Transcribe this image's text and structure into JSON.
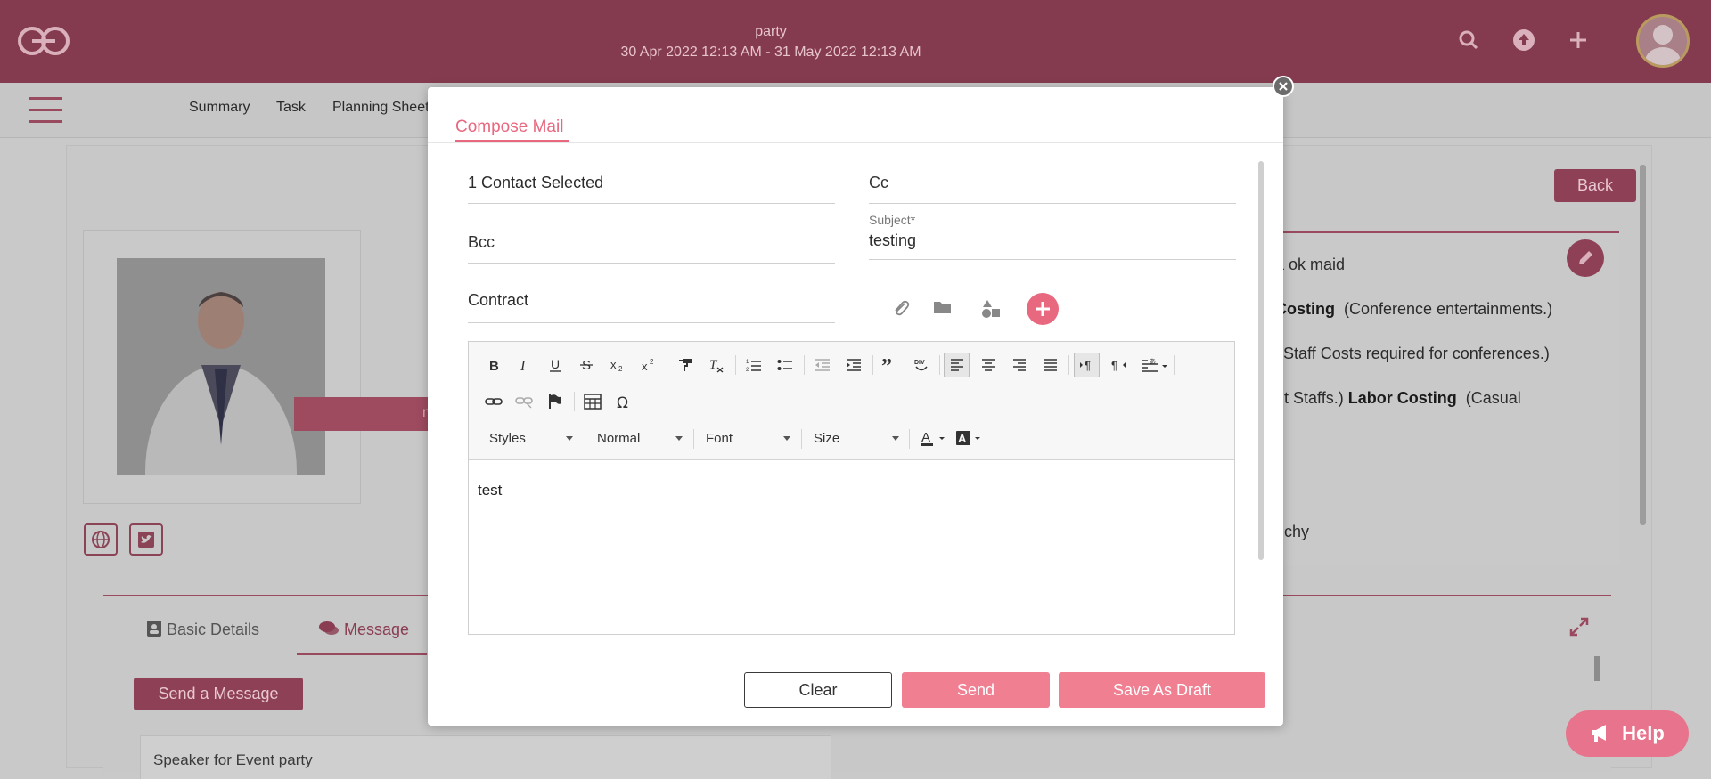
{
  "header": {
    "event_title": "party",
    "event_dates": "30 Apr 2022 12:13 AM - 31 May 2022 12:13 AM",
    "brand_color": "#853b4f"
  },
  "nav": {
    "items": [
      "Summary",
      "Task",
      "Planning Sheet"
    ]
  },
  "background": {
    "back_label": "Back",
    "detail_lines": [
      {
        "plain": "a ok maid",
        "bold": "",
        "rest": ""
      },
      {
        "plain": "",
        "bold": "Costing",
        "rest": "  (Conference entertainments.)"
      },
      {
        "plain": "l Staff Costs required for conferences.)",
        "bold": "",
        "rest": ""
      },
      {
        "plain": "nt Staffs.) ",
        "bold": "Labor Costing",
        "rest": "  (Casual"
      },
      {
        "plain": "richy",
        "bold": "",
        "rest": ""
      }
    ],
    "strip_text": "m",
    "tabs": {
      "basic": "Basic Details",
      "message": "Message"
    },
    "send_message_label": "Send a Message",
    "message_preview": "Speaker for Event party",
    "help_label": "Help"
  },
  "modal": {
    "tab_label": "Compose Mail",
    "to_value": "1 Contact Selected",
    "cc_placeholder": "Cc",
    "bcc_placeholder": "Bcc",
    "subject_label": "Subject*",
    "subject_value": "testing",
    "template_value": "Contract",
    "editor": {
      "styles_label": "Styles",
      "format_label": "Normal",
      "font_label": "Font",
      "size_label": "Size",
      "body_text": "test"
    },
    "buttons": {
      "clear": "Clear",
      "send": "Send",
      "save_draft": "Save As Draft"
    },
    "accent_color": "#e8687f"
  }
}
